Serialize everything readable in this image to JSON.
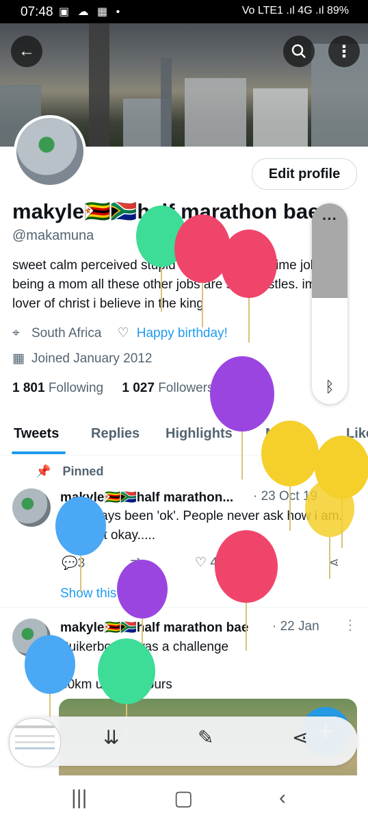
{
  "status_bar": {
    "time": "07:48",
    "right_text": "Vo LTE1 .ıl 4G .ıl 89%"
  },
  "banner": {
    "back_icon": "arrow-left-icon",
    "search_icon": "search-icon",
    "more_icon": "more-vertical-icon"
  },
  "profile": {
    "edit_button": "Edit profile",
    "display_name": "makyle🇿🇼🇿🇦half marathon bae",
    "handle": "@makamuna",
    "bio": "sweet calm perceived stupid by many. my fulltime job is being a mom all these other jobs are side hustles.  im a lover of  christ i believe in the king",
    "location": "South Africa",
    "birthday_link": "Happy birthday!",
    "joined": "Joined January 2012",
    "following_count": "1 801",
    "following_label": "Following",
    "followers_count": "1 027",
    "followers_label": "Followers"
  },
  "tabs": [
    "Tweets",
    "Replies",
    "Highlights",
    "Media",
    "Likes"
  ],
  "tweets": [
    {
      "pinned_label": "Pinned",
      "name": "makyle🇿🇼🇿🇦half marathon...",
      "date": "· 23 Oct 19",
      "text": "Ive always been 'ok'. People never ask how i am. I am not okay.....",
      "replies": "3",
      "likes": "4",
      "show_thread": "Show this thread"
    },
    {
      "name": "makyle🇿🇼🇿🇦half marathon bae",
      "date": "· 22 Jan",
      "line1": "Suikerbooss was a challenge",
      "line2": "30km under 3hours"
    }
  ],
  "colors": {
    "accent": "#1d9bf0",
    "balloon_green": "#3ddc97",
    "balloon_pink": "#f0456b",
    "balloon_purple": "#9b45e0",
    "balloon_yellow": "#f5cf2a",
    "balloon_blue": "#4aa8f5"
  }
}
